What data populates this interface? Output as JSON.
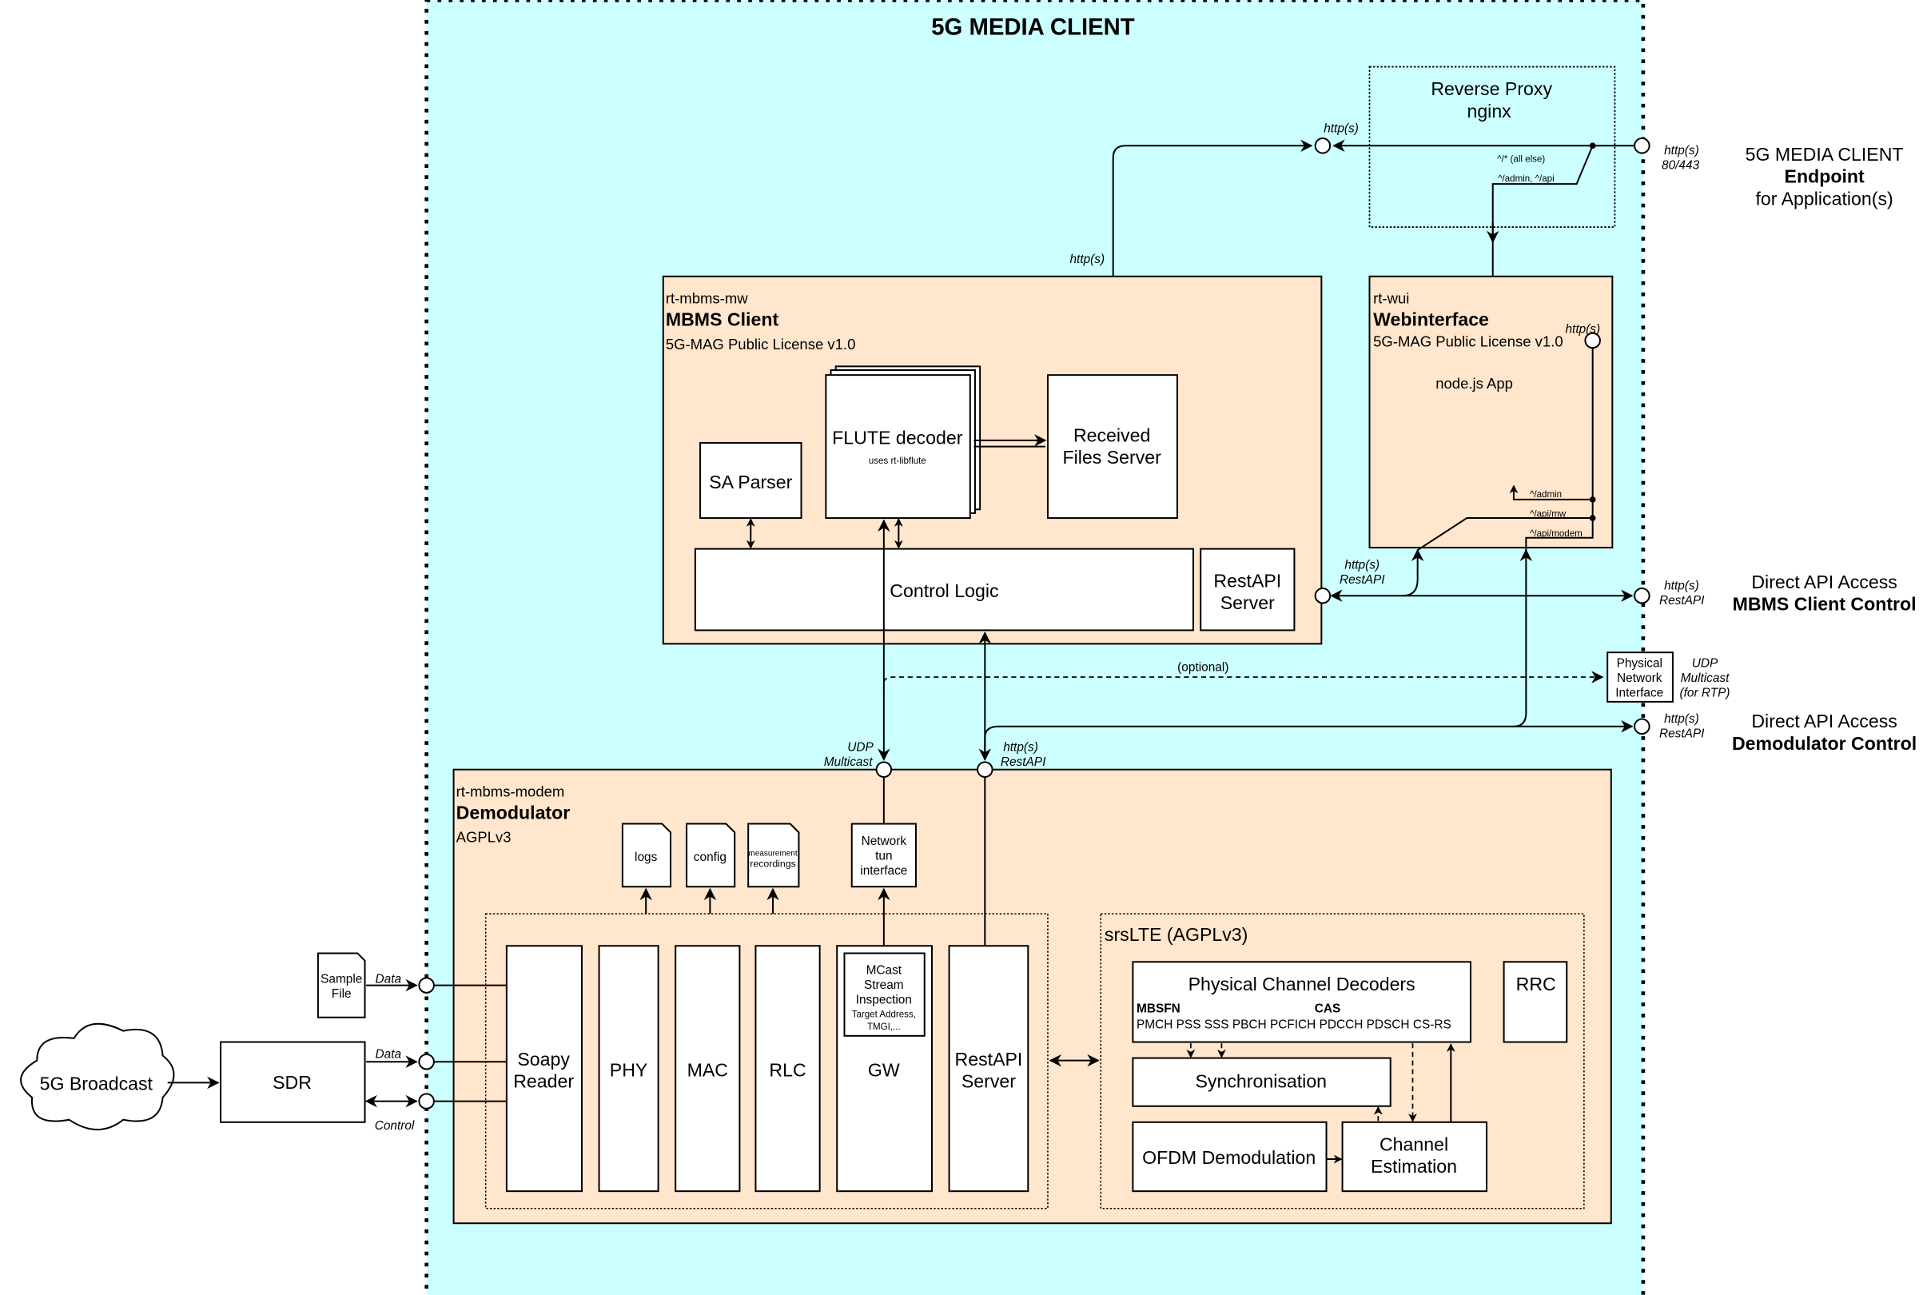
{
  "title": "5G MEDIA CLIENT",
  "colors": {
    "container": "#ccffff",
    "component": "#ffe6cc",
    "proxy": "#e6e6e6"
  },
  "proxy": {
    "line1": "Reverse Proxy",
    "line2": "nginx",
    "route_else": "^/* (all else)",
    "route_admin_api": "^/admin, ^/api"
  },
  "endpoint": {
    "line1": "5G MEDIA CLIENT",
    "line2": "Endpoint",
    "line3": "for Application(s)",
    "port_label1": "http(s)",
    "port_label2": "80/443"
  },
  "mbms": {
    "pkg": "rt-mbms-mw",
    "name": "MBMS Client",
    "license": "5G-MAG Public License v1.0",
    "flute": "FLUTE decoder",
    "flute_sub": "uses rt-libflute",
    "received1": "Received",
    "received2": "Files Server",
    "sa_parser": "SA Parser",
    "control_logic": "Control Logic",
    "restapi1": "RestAPI",
    "restapi2": "Server"
  },
  "wui": {
    "pkg": "rt-wui",
    "name": "Webinterface",
    "license": "5G-MAG Public License v1.0",
    "app": "node.js App",
    "route_admin": "^/admin",
    "route_mw": "^/api/mw",
    "route_modem": "^/api/modem",
    "port_label": "http(s)"
  },
  "labels": {
    "http_top": "http(s)",
    "http_mid": "http(s)",
    "rest1": "http(s)",
    "rest2": "RestAPI",
    "optional": "(optional)",
    "udp1": "UDP",
    "udp2": "Multicast",
    "modem_http1": "http(s)",
    "modem_http2": "RestAPI",
    "data1": "Data",
    "data2": "Data",
    "control": "Control",
    "ext_rest1a": "http(s)",
    "ext_rest1b": "RestAPI",
    "ext_rest2a": "http(s)",
    "ext_rest2b": "RestAPI",
    "rtp1": "UDP",
    "rtp2": "Multicast",
    "rtp3": "(for RTP)"
  },
  "pni": {
    "l1": "Physical",
    "l2": "Network",
    "l3": "Interface"
  },
  "direct1": {
    "l1": "Direct API Access",
    "l2": "MBMS Client Control"
  },
  "direct2": {
    "l1": "Direct API Access",
    "l2": "Demodulator Control"
  },
  "modem": {
    "pkg": "rt-mbms-modem",
    "name": "Demodulator",
    "license": "AGPLv3",
    "files": [
      "logs",
      "config",
      "measurement",
      "recordings"
    ],
    "tun": [
      "Network",
      "tun",
      "interface"
    ],
    "soapy": [
      "Soapy",
      "Reader"
    ],
    "phy": "PHY",
    "mac": "MAC",
    "rlc": "RLC",
    "gw": "GW",
    "mcast": [
      "MCast",
      "Stream",
      "Inspection",
      "Target Address,",
      "TMGI,..."
    ],
    "restapi": [
      "RestAPI",
      "Server"
    ]
  },
  "srslte": {
    "title": "srsLTE (AGPLv3)",
    "pcd": "Physical Channel Decoders",
    "mbsfn": "MBSFN",
    "cas": "CAS",
    "channels": "PMCH PSS SSS PBCH PCFICH PDCCH PDSCH CS-RS",
    "rrc": "RRC",
    "sync": "Synchronisation",
    "ofdm": "OFDM Demodulation",
    "chest1": "Channel",
    "chest2": "Estimation"
  },
  "sample_file": [
    "Sample",
    "File"
  ],
  "sdr": "SDR",
  "broadcast": "5G Broadcast"
}
